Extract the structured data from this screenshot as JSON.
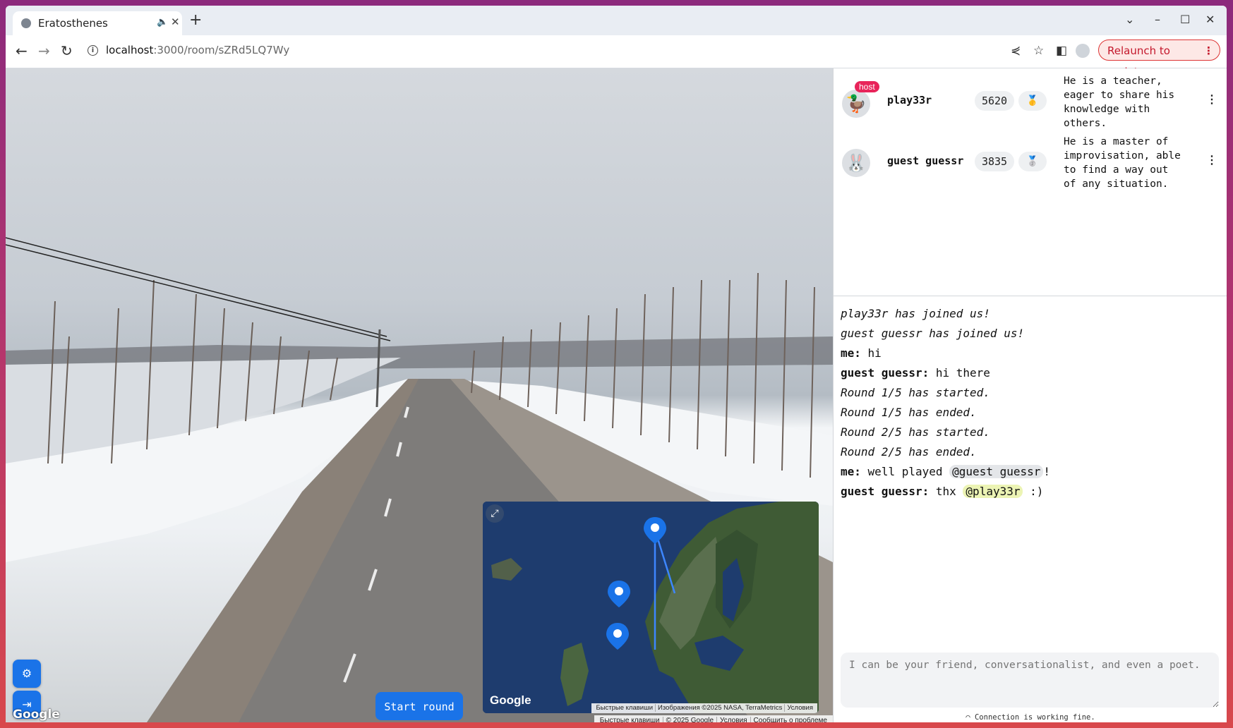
{
  "browser": {
    "tab_title": "Eratosthenes",
    "url_host": "localhost",
    "url_path": ":3000/room/sZRd5LQ7Wy",
    "relaunch_label": "Relaunch to update"
  },
  "streetview": {
    "google_mark": "Google",
    "attribution": [
      "Быстрые клавиши",
      "© 2025 Google",
      "Условия",
      "Сообщить о проблеме"
    ],
    "start_round_label": "Start round",
    "settings_icon": "gear-icon",
    "leave_icon": "exit-icon"
  },
  "minimap": {
    "google_mark": "Google",
    "attribution": [
      "Быстрые клавиши",
      "Изображения ©2025 NASA, TerraMetrics",
      "Условия"
    ]
  },
  "players": [
    {
      "name": "play33r",
      "badge": "host",
      "score": "5620",
      "medal": "🥇",
      "avatar": "🦆",
      "bio": "He is a teacher, eager to share his knowledge with others."
    },
    {
      "name": "guest guessr",
      "badge": "",
      "score": "3835",
      "medal": "🥈",
      "avatar": "🐰",
      "bio": "He is a master of improvisation, able to find a way out of any situation."
    }
  ],
  "chat": {
    "sys1": "play33r has joined us!",
    "sys2": "guest guessr has joined us!",
    "m1_who": "me:",
    "m1_text": "hi",
    "m2_who": "guest guessr:",
    "m2_text": "hi there",
    "sys3": "Round 1/5 has started.",
    "sys4": "Round 1/5 has ended.",
    "sys5": "Round 2/5 has started.",
    "sys6": "Round 2/5 has ended.",
    "m3_who": "me:",
    "m3_pre": "well played",
    "m3_mention": "@guest guessr",
    "m3_post": "!",
    "m4_who": "guest guessr:",
    "m4_pre": "thx",
    "m4_mention": "@play33r",
    "m4_post": ":)",
    "input_placeholder": "I can be your friend, conversationalist, and even a poet."
  },
  "connection_status": "Connection is working fine."
}
